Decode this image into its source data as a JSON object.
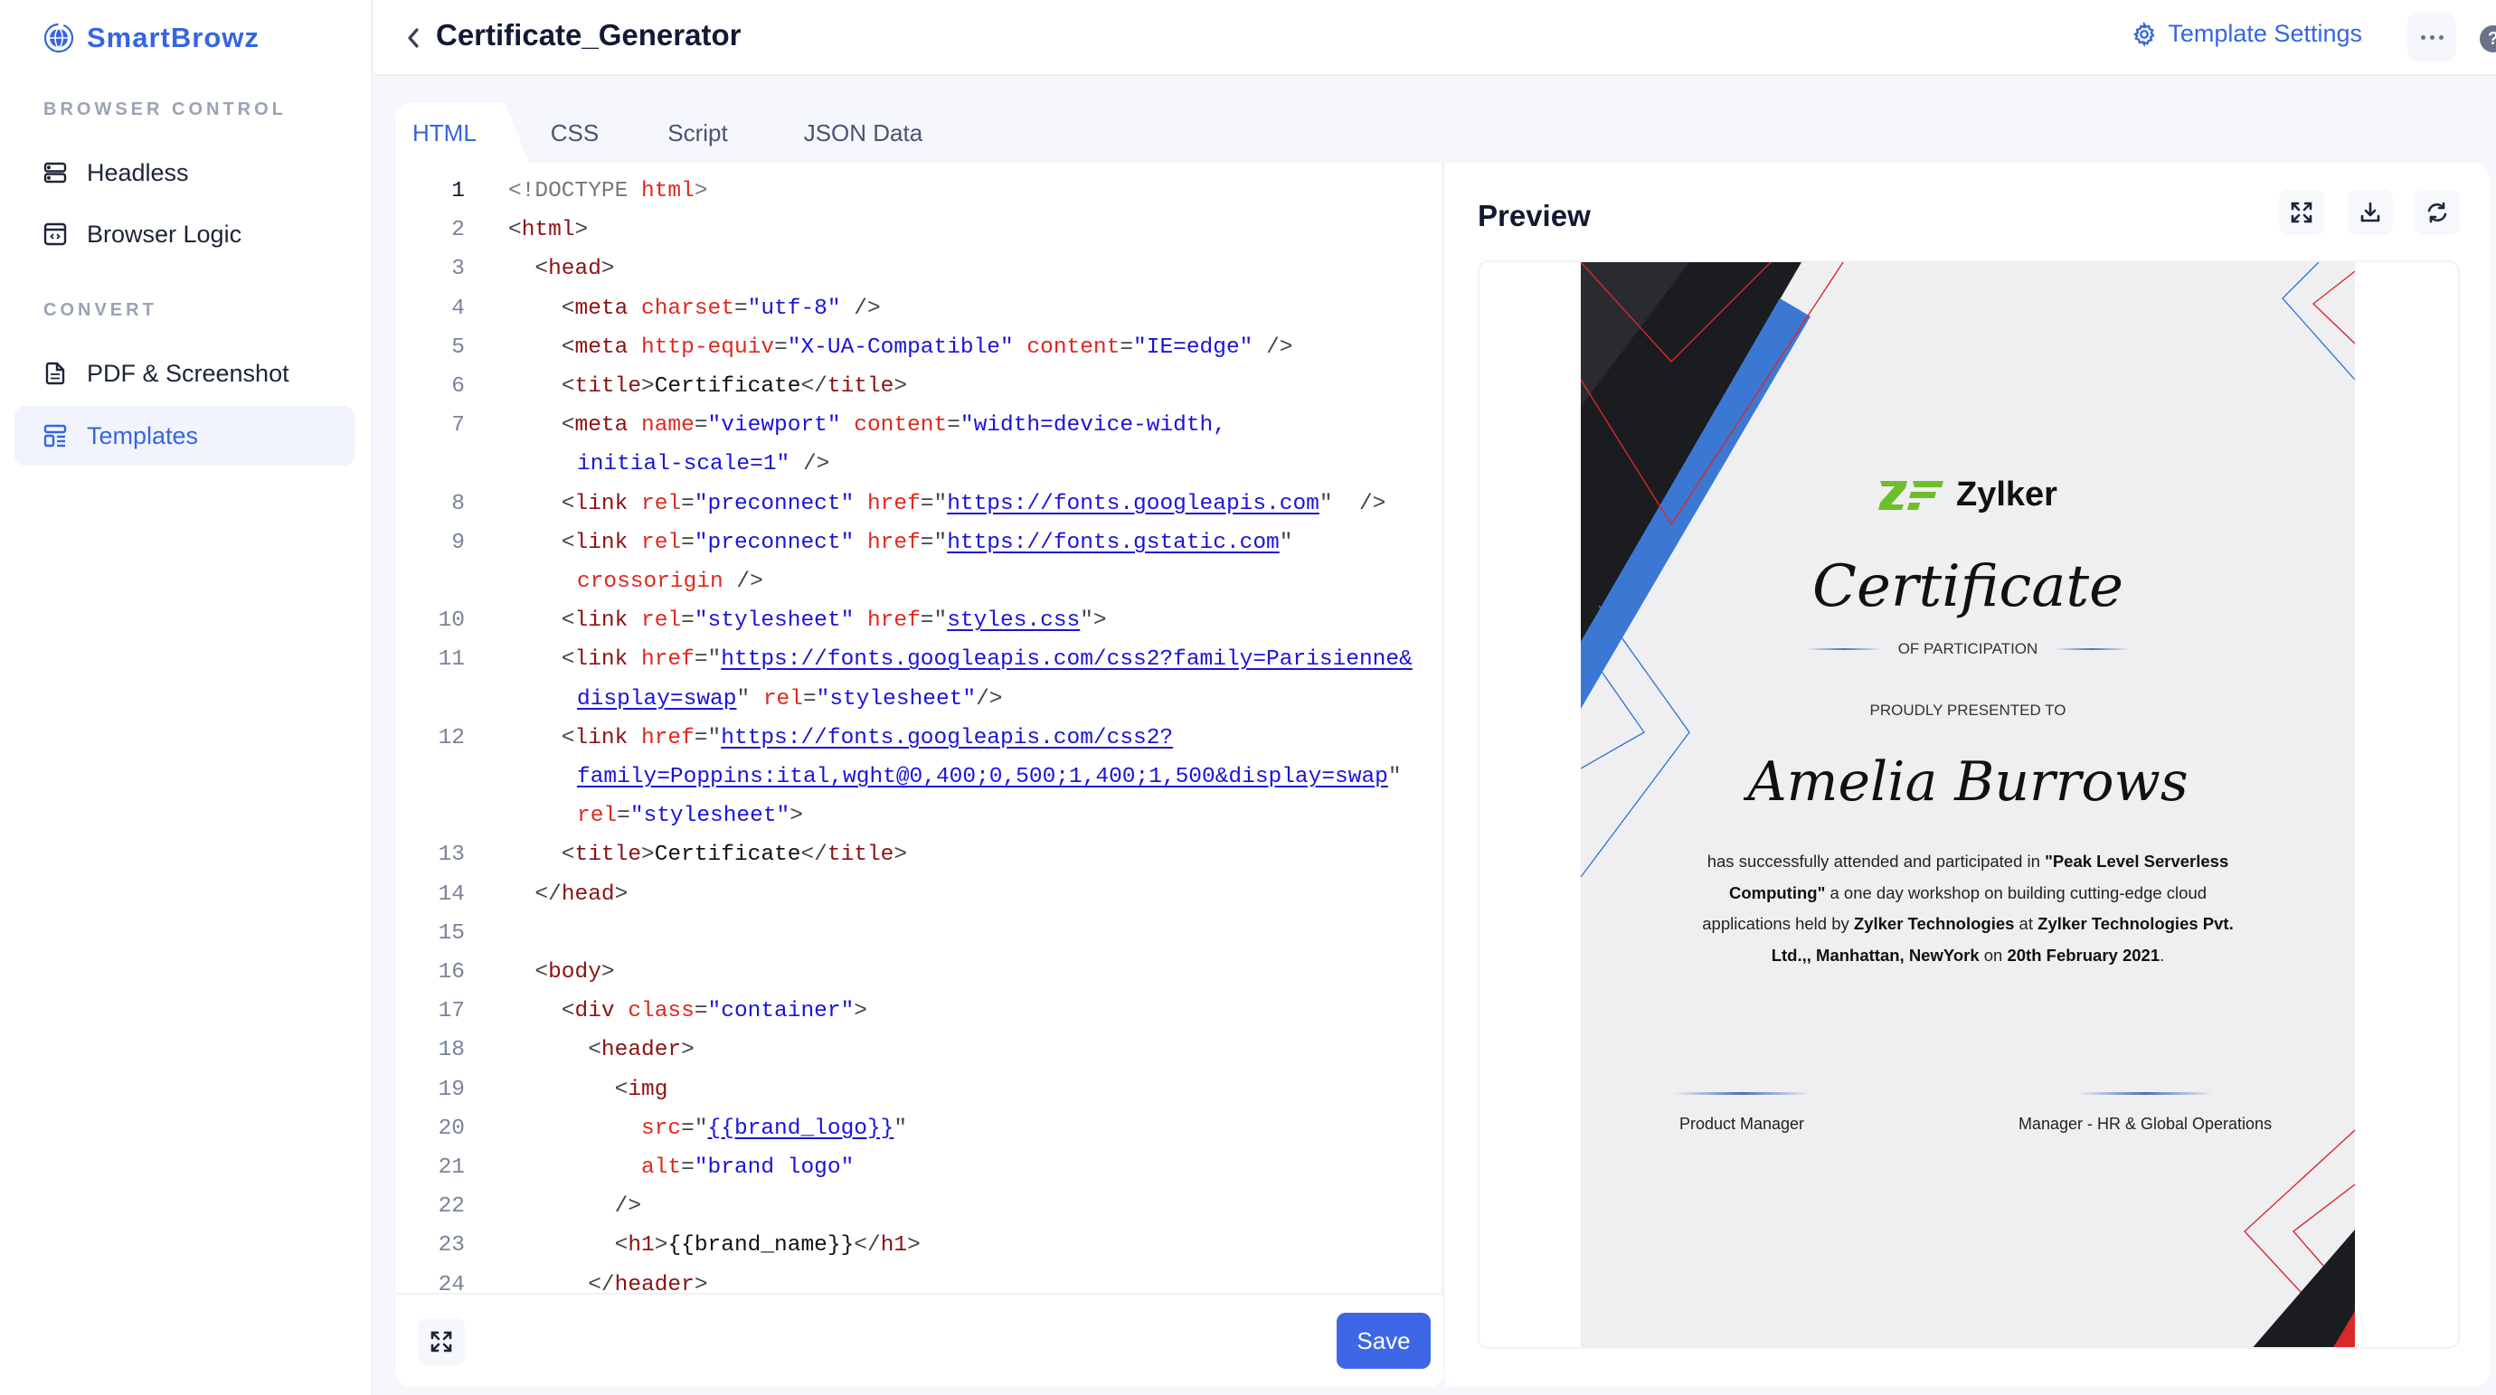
{
  "app": {
    "name": "SmartBrowz",
    "colors": {
      "accent": "#3565e0",
      "save": "#3d67e6",
      "code_tag": "#8b1212",
      "code_attr": "#e0281e",
      "code_string": "#1a14d6"
    }
  },
  "sidebar": {
    "sections": [
      {
        "label": "BROWSER CONTROL",
        "items": [
          {
            "label": "Headless",
            "icon": "server-icon"
          },
          {
            "label": "Browser Logic",
            "icon": "code-window-icon"
          }
        ]
      },
      {
        "label": "CONVERT",
        "items": [
          {
            "label": "PDF & Screenshot",
            "icon": "document-icon"
          },
          {
            "label": "Templates",
            "icon": "template-icon",
            "active": true
          }
        ]
      }
    ]
  },
  "header": {
    "title": "Certificate_Generator",
    "template_settings": "Template Settings",
    "help": "?"
  },
  "tabs": [
    {
      "label": "HTML",
      "active": true
    },
    {
      "label": "CSS"
    },
    {
      "label": "Script"
    },
    {
      "label": "JSON Data"
    }
  ],
  "editor": {
    "save_label": "Save",
    "current_line": 1,
    "lines": [
      {
        "n": "1",
        "tokens": [
          [
            "dt",
            "<!DOCTYPE "
          ],
          [
            "at",
            "html"
          ],
          [
            "dt",
            ">"
          ]
        ]
      },
      {
        "n": "2",
        "tokens": [
          [
            "pu",
            "<"
          ],
          [
            "tg",
            "html"
          ],
          [
            "pu",
            ">"
          ]
        ]
      },
      {
        "n": "3",
        "tokens": [
          [
            "pu",
            "  <"
          ],
          [
            "tg",
            "head"
          ],
          [
            "pu",
            ">"
          ]
        ]
      },
      {
        "n": "4",
        "tokens": [
          [
            "pu",
            "    <"
          ],
          [
            "tg",
            "meta"
          ],
          [
            "pu",
            " "
          ],
          [
            "at",
            "charset"
          ],
          [
            "pu",
            "="
          ],
          [
            "st",
            "\"utf-8\""
          ],
          [
            "pu",
            " />"
          ]
        ]
      },
      {
        "n": "5",
        "tokens": [
          [
            "pu",
            "    <"
          ],
          [
            "tg",
            "meta"
          ],
          [
            "pu",
            " "
          ],
          [
            "at",
            "http-equiv"
          ],
          [
            "pu",
            "="
          ],
          [
            "st",
            "\"X-UA-Compatible\""
          ],
          [
            "pu",
            " "
          ],
          [
            "at",
            "content"
          ],
          [
            "pu",
            "="
          ],
          [
            "st",
            "\"IE=edge\""
          ],
          [
            "pu",
            " />"
          ]
        ]
      },
      {
        "n": "6",
        "tokens": [
          [
            "pu",
            "    <"
          ],
          [
            "tg",
            "title"
          ],
          [
            "pu",
            ">"
          ],
          [
            "tx",
            "Certificate"
          ],
          [
            "pu",
            "</"
          ],
          [
            "tg",
            "title"
          ],
          [
            "pu",
            ">"
          ]
        ]
      },
      {
        "n": "7",
        "tokens": [
          [
            "pu",
            "    <"
          ],
          [
            "tg",
            "meta"
          ],
          [
            "pu",
            " "
          ],
          [
            "at",
            "name"
          ],
          [
            "pu",
            "="
          ],
          [
            "st",
            "\"viewport\""
          ],
          [
            "pu",
            " "
          ],
          [
            "at",
            "content"
          ],
          [
            "pu",
            "="
          ],
          [
            "st",
            "\"width=device-width,"
          ]
        ]
      },
      {
        "n": "",
        "cont": true,
        "tokens": [
          [
            "st",
            "initial-scale=1\""
          ],
          [
            "pu",
            " />"
          ]
        ]
      },
      {
        "n": "8",
        "tokens": [
          [
            "pu",
            "    <"
          ],
          [
            "tg",
            "link"
          ],
          [
            "pu",
            " "
          ],
          [
            "at",
            "rel"
          ],
          [
            "pu",
            "="
          ],
          [
            "st",
            "\"preconnect\""
          ],
          [
            "pu",
            " "
          ],
          [
            "at",
            "href"
          ],
          [
            "pu",
            "=\""
          ],
          [
            "lk",
            "https://fonts.googleapis.com"
          ],
          [
            "pu",
            "\"  />"
          ]
        ]
      },
      {
        "n": "9",
        "tokens": [
          [
            "pu",
            "    <"
          ],
          [
            "tg",
            "link"
          ],
          [
            "pu",
            " "
          ],
          [
            "at",
            "rel"
          ],
          [
            "pu",
            "="
          ],
          [
            "st",
            "\"preconnect\""
          ],
          [
            "pu",
            " "
          ],
          [
            "at",
            "href"
          ],
          [
            "pu",
            "=\""
          ],
          [
            "lk",
            "https://fonts.gstatic.com"
          ],
          [
            "pu",
            "\""
          ]
        ]
      },
      {
        "n": "",
        "cont": true,
        "tokens": [
          [
            "at",
            "crossorigin"
          ],
          [
            "pu",
            " />"
          ]
        ]
      },
      {
        "n": "10",
        "tokens": [
          [
            "pu",
            "    <"
          ],
          [
            "tg",
            "link"
          ],
          [
            "pu",
            " "
          ],
          [
            "at",
            "rel"
          ],
          [
            "pu",
            "="
          ],
          [
            "st",
            "\"stylesheet\""
          ],
          [
            "pu",
            " "
          ],
          [
            "at",
            "href"
          ],
          [
            "pu",
            "=\""
          ],
          [
            "lk",
            "styles.css"
          ],
          [
            "pu",
            "\">"
          ]
        ]
      },
      {
        "n": "11",
        "tokens": [
          [
            "pu",
            "    <"
          ],
          [
            "tg",
            "link"
          ],
          [
            "pu",
            " "
          ],
          [
            "at",
            "href"
          ],
          [
            "pu",
            "=\""
          ],
          [
            "lk",
            "https://fonts.googleapis.com/css2?family=Parisienne&"
          ]
        ]
      },
      {
        "n": "",
        "cont": true,
        "tokens": [
          [
            "lk",
            "display=swap"
          ],
          [
            "pu",
            "\" "
          ],
          [
            "at",
            "rel"
          ],
          [
            "pu",
            "="
          ],
          [
            "st",
            "\"stylesheet\""
          ],
          [
            "pu",
            "/>"
          ]
        ]
      },
      {
        "n": "12",
        "tokens": [
          [
            "pu",
            "    <"
          ],
          [
            "tg",
            "link"
          ],
          [
            "pu",
            " "
          ],
          [
            "at",
            "href"
          ],
          [
            "pu",
            "=\""
          ],
          [
            "lk",
            "https://fonts.googleapis.com/css2?"
          ]
        ]
      },
      {
        "n": "",
        "cont": true,
        "tokens": [
          [
            "lk",
            "family=Poppins:ital,wght@0,400;0,500;1,400;1,500&display=swap"
          ],
          [
            "pu",
            "\""
          ]
        ]
      },
      {
        "n": "",
        "cont": true,
        "tokens": [
          [
            "at",
            "rel"
          ],
          [
            "pu",
            "="
          ],
          [
            "st",
            "\"stylesheet\""
          ],
          [
            "pu",
            ">"
          ]
        ]
      },
      {
        "n": "13",
        "tokens": [
          [
            "pu",
            "    <"
          ],
          [
            "tg",
            "title"
          ],
          [
            "pu",
            ">"
          ],
          [
            "tx",
            "Certificate"
          ],
          [
            "pu",
            "</"
          ],
          [
            "tg",
            "title"
          ],
          [
            "pu",
            ">"
          ]
        ]
      },
      {
        "n": "14",
        "tokens": [
          [
            "pu",
            "  </"
          ],
          [
            "tg",
            "head"
          ],
          [
            "pu",
            ">"
          ]
        ]
      },
      {
        "n": "15",
        "tokens": []
      },
      {
        "n": "16",
        "tokens": [
          [
            "pu",
            "  <"
          ],
          [
            "tg",
            "body"
          ],
          [
            "pu",
            ">"
          ]
        ]
      },
      {
        "n": "17",
        "tokens": [
          [
            "pu",
            "    <"
          ],
          [
            "tg",
            "div"
          ],
          [
            "pu",
            " "
          ],
          [
            "at",
            "class"
          ],
          [
            "pu",
            "="
          ],
          [
            "st",
            "\"container\""
          ],
          [
            "pu",
            ">"
          ]
        ]
      },
      {
        "n": "18",
        "tokens": [
          [
            "pu",
            "      <"
          ],
          [
            "tg",
            "header"
          ],
          [
            "pu",
            ">"
          ]
        ]
      },
      {
        "n": "19",
        "tokens": [
          [
            "pu",
            "        <"
          ],
          [
            "tg",
            "img"
          ]
        ]
      },
      {
        "n": "20",
        "tokens": [
          [
            "pu",
            "          "
          ],
          [
            "at",
            "src"
          ],
          [
            "pu",
            "=\""
          ],
          [
            "lk",
            "{{brand_logo}}"
          ],
          [
            "pu",
            "\""
          ]
        ]
      },
      {
        "n": "21",
        "tokens": [
          [
            "pu",
            "          "
          ],
          [
            "at",
            "alt"
          ],
          [
            "pu",
            "="
          ],
          [
            "st",
            "\"brand logo\""
          ]
        ]
      },
      {
        "n": "22",
        "tokens": [
          [
            "pu",
            "        />"
          ]
        ]
      },
      {
        "n": "23",
        "tokens": [
          [
            "pu",
            "        <"
          ],
          [
            "tg",
            "h1"
          ],
          [
            "pu",
            ">"
          ],
          [
            "tx",
            "{{brand_name}}"
          ],
          [
            "pu",
            "</"
          ],
          [
            "tg",
            "h1"
          ],
          [
            "pu",
            ">"
          ]
        ]
      },
      {
        "n": "24",
        "tokens": [
          [
            "pu",
            "      </"
          ],
          [
            "tg",
            "header"
          ],
          [
            "pu",
            ">"
          ]
        ]
      }
    ]
  },
  "preview": {
    "title": "Preview",
    "certificate": {
      "brand": "Zylker",
      "title": "Certificate",
      "subtitle": "OF PARTICIPATION",
      "presented_to": "PROUDLY PRESENTED TO",
      "recipient": "Amelia Burrows",
      "body": [
        [
          "n",
          "has successfully attended and participated in "
        ],
        [
          "b",
          "\"Peak Level Serverless Computing\""
        ],
        [
          "n",
          " a one day workshop on building cutting-edge cloud applications held by "
        ],
        [
          "b",
          "Zylker Technologies"
        ],
        [
          "n",
          " at "
        ],
        [
          "b",
          "Zylker Technologies Pvt. Ltd.,, Manhattan, NewYork"
        ],
        [
          "n",
          " on "
        ],
        [
          "b",
          "20th February 2021"
        ],
        [
          "n",
          "."
        ]
      ],
      "signatories": [
        "Product Manager",
        "Manager - HR & Global Operations"
      ],
      "colors": {
        "logo_green": "#6cbf2a",
        "stripe_blue": "#3a78d4",
        "stripe_dark": "#1b1c1f",
        "line_red": "#d8292b"
      }
    }
  }
}
